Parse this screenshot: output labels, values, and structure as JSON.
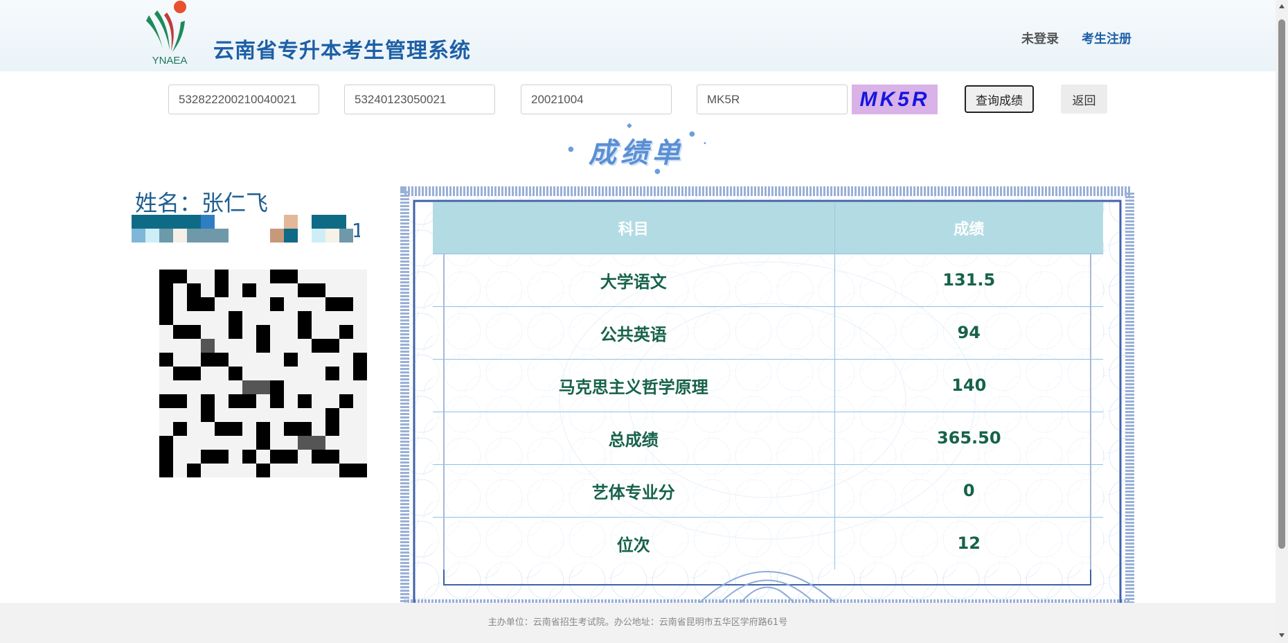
{
  "header": {
    "logo_text": "YNAEA",
    "site_title": "云南省专升本考生管理系统",
    "nav": {
      "login_status": "未登录",
      "register": "考生注册"
    }
  },
  "query": {
    "id_number": "532822200210040021",
    "exam_number": "53240123050021",
    "birth_date": "20021004",
    "captcha_input": "MK5R",
    "captcha_code": "MK5R",
    "query_button": "查询成绩",
    "back_button": "返回"
  },
  "report": {
    "title": "成绩单",
    "name_label": "姓名：张仁飞",
    "table": {
      "headers": [
        "科目",
        "成绩"
      ],
      "rows": [
        {
          "subject": "大学语文",
          "score": "131.5"
        },
        {
          "subject": "公共英语",
          "score": "94"
        },
        {
          "subject": "马克思主义哲学原理",
          "score": "140"
        },
        {
          "subject": "总成绩",
          "score": "365.50"
        },
        {
          "subject": "艺体专业分",
          "score": "0"
        },
        {
          "subject": "位次",
          "score": "12"
        }
      ]
    }
  },
  "footer": {
    "text": "主办单位：云南省招生考试院。办公地址：云南省昆明市五华区学府路61号"
  },
  "colors": {
    "brand_blue": "#1d5fa6",
    "table_header": "#b3dbe3",
    "score_text": "#17624a",
    "captcha_bg": "#d9b3e8"
  }
}
